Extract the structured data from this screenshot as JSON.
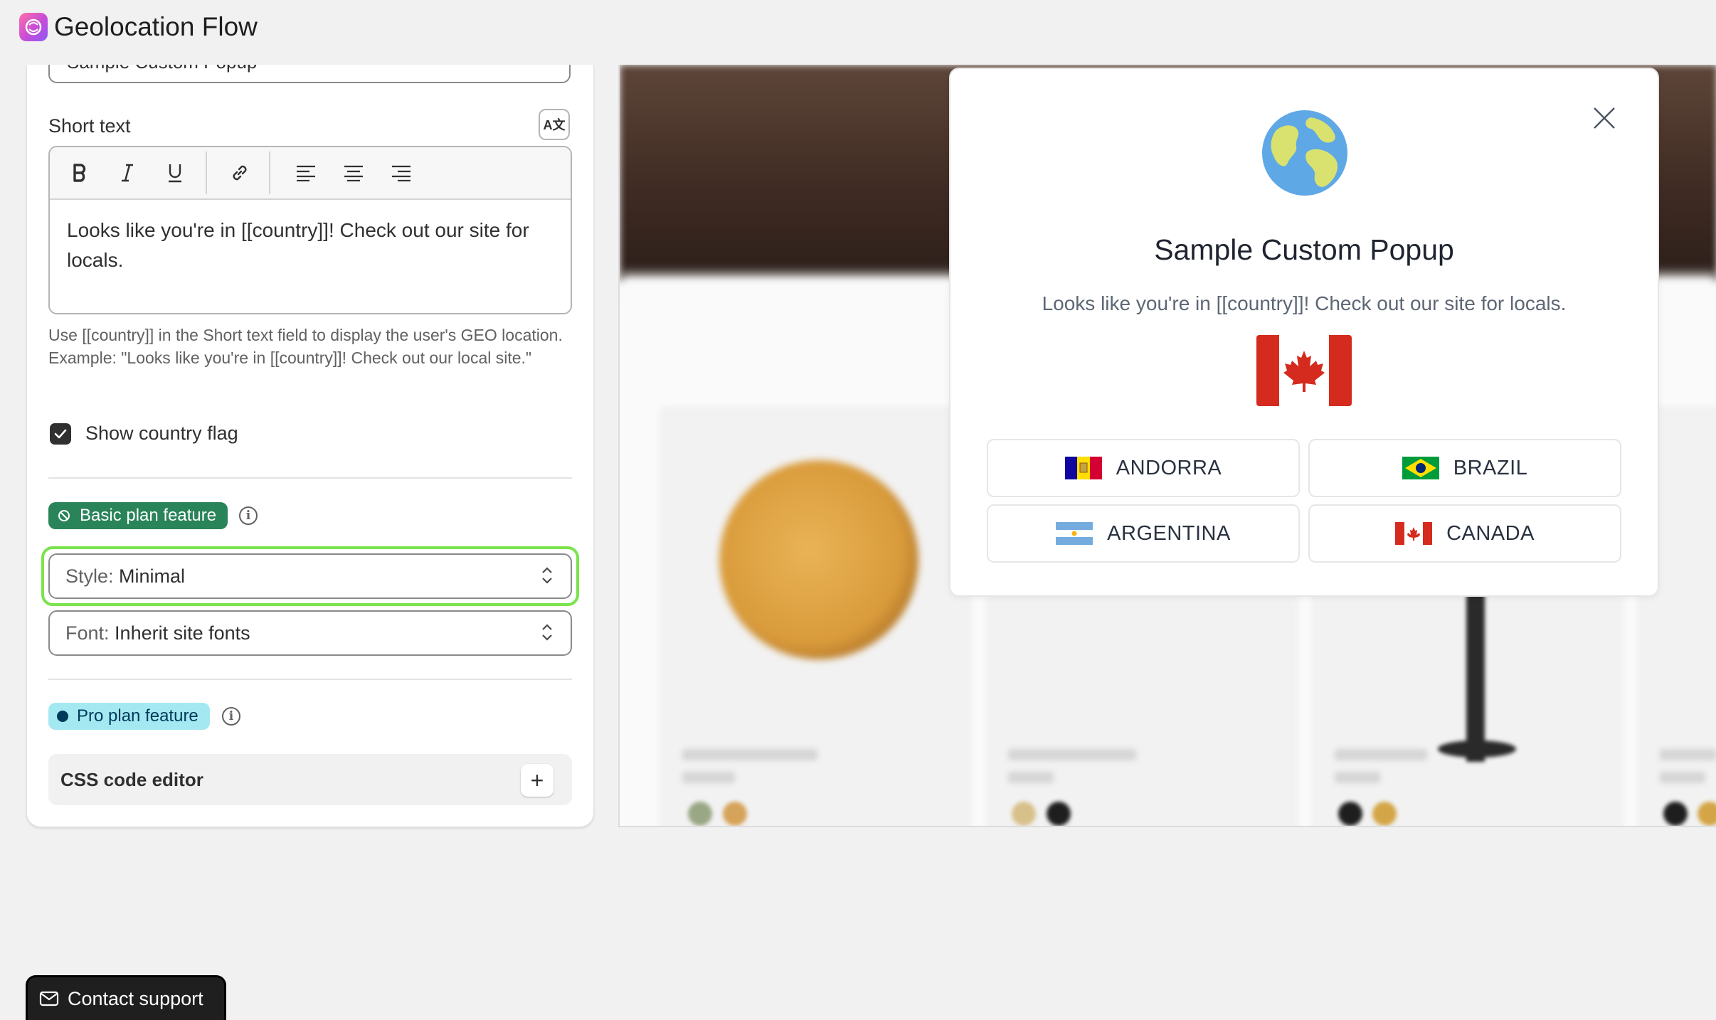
{
  "app": {
    "title": "Geolocation Flow"
  },
  "settings": {
    "popup_title_value": "Sample Custom Popup",
    "short_text": {
      "label": "Short text",
      "translate_icon_text": "A文",
      "content": "Looks like you're in [[country]]! Check out our site for locals.",
      "help": "Use [[country]] in the Short text field to display the user's GEO location. Example: \"Looks like you're in [[country]]! Check out our local site.\""
    },
    "toolbar": [
      "bold",
      "italic",
      "underline",
      "link",
      "align-left",
      "align-center",
      "align-right"
    ],
    "show_flag": {
      "label": "Show country flag",
      "checked": true
    },
    "basic_badge": "Basic plan feature",
    "style_select": {
      "key": "Style:",
      "value": "Minimal"
    },
    "font_select": {
      "key": "Font:",
      "value": "Inherit site fonts"
    },
    "pro_badge": "Pro plan feature",
    "css_editor": {
      "label": "CSS code editor",
      "button": "+"
    }
  },
  "preview": {
    "popup": {
      "title": "Sample Custom Popup",
      "text": "Looks like you're in [[country]]! Check out our site for locals.",
      "big_flag": "canada",
      "countries": [
        {
          "name": "ANDORRA",
          "flag": "andorra"
        },
        {
          "name": "BRAZIL",
          "flag": "brazil"
        },
        {
          "name": "ARGENTINA",
          "flag": "argentina"
        },
        {
          "name": "CANADA",
          "flag": "canada"
        }
      ]
    }
  },
  "contact": {
    "label": "Contact support"
  },
  "colors": {
    "basic_badge": "#29845a",
    "pro_badge": "#a4e8f2",
    "focus_ring": "#7be34c",
    "canada_red": "#d52b1e"
  }
}
